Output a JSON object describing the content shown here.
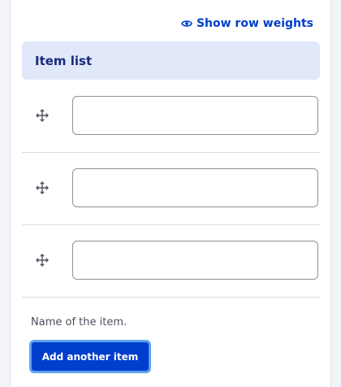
{
  "toolbar": {
    "show_weights_label": "Show row weights",
    "show_weights_icon": "eye-icon"
  },
  "table": {
    "header": "Item list",
    "rows": [
      {
        "drag_icon": "move-icon",
        "value": ""
      },
      {
        "drag_icon": "move-icon",
        "value": ""
      },
      {
        "drag_icon": "move-icon",
        "value": ""
      }
    ]
  },
  "field": {
    "description": "Name of the item."
  },
  "actions": {
    "add_label": "Add another item"
  },
  "colors": {
    "accent": "#003ecc",
    "header_bg": "#e0e8fa",
    "focus_ring": "#5ea3f0"
  }
}
